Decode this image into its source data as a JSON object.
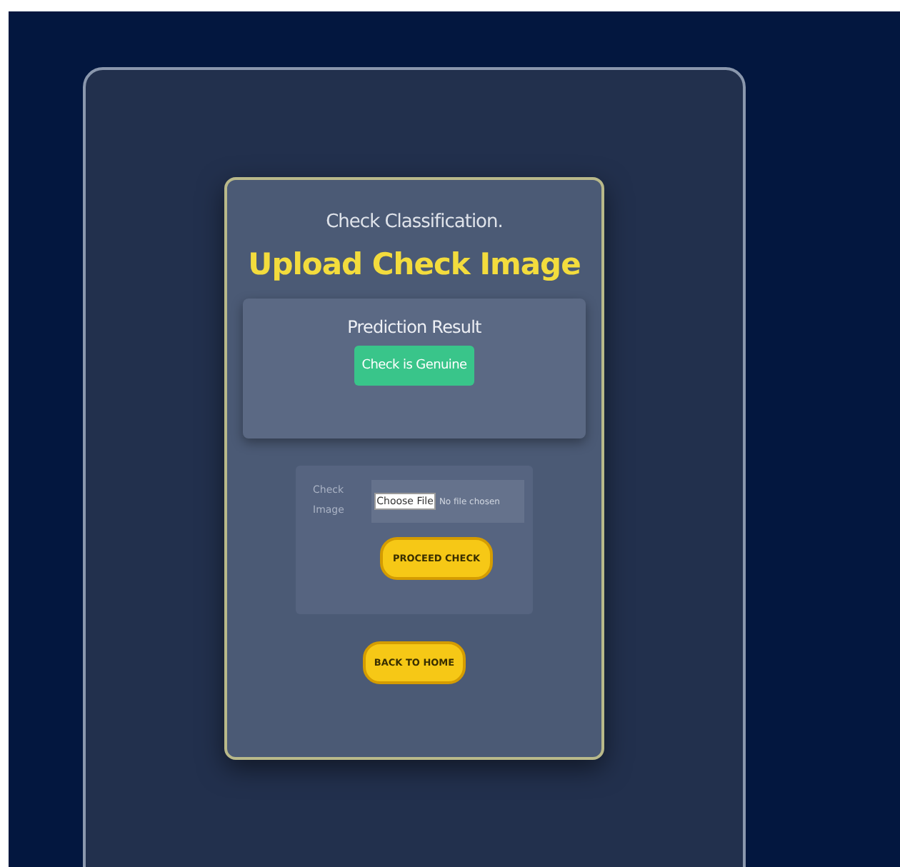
{
  "header": {
    "subtitle": "Check Classification.",
    "title": "Upload Check Image"
  },
  "prediction": {
    "heading": "Prediction Result",
    "result": "Check is Genuine"
  },
  "upload_form": {
    "label": "Check Image",
    "file_button": "Choose File",
    "file_status": "No file chosen",
    "submit": "PROCEED CHECK"
  },
  "back_button": "BACK TO HOME"
}
